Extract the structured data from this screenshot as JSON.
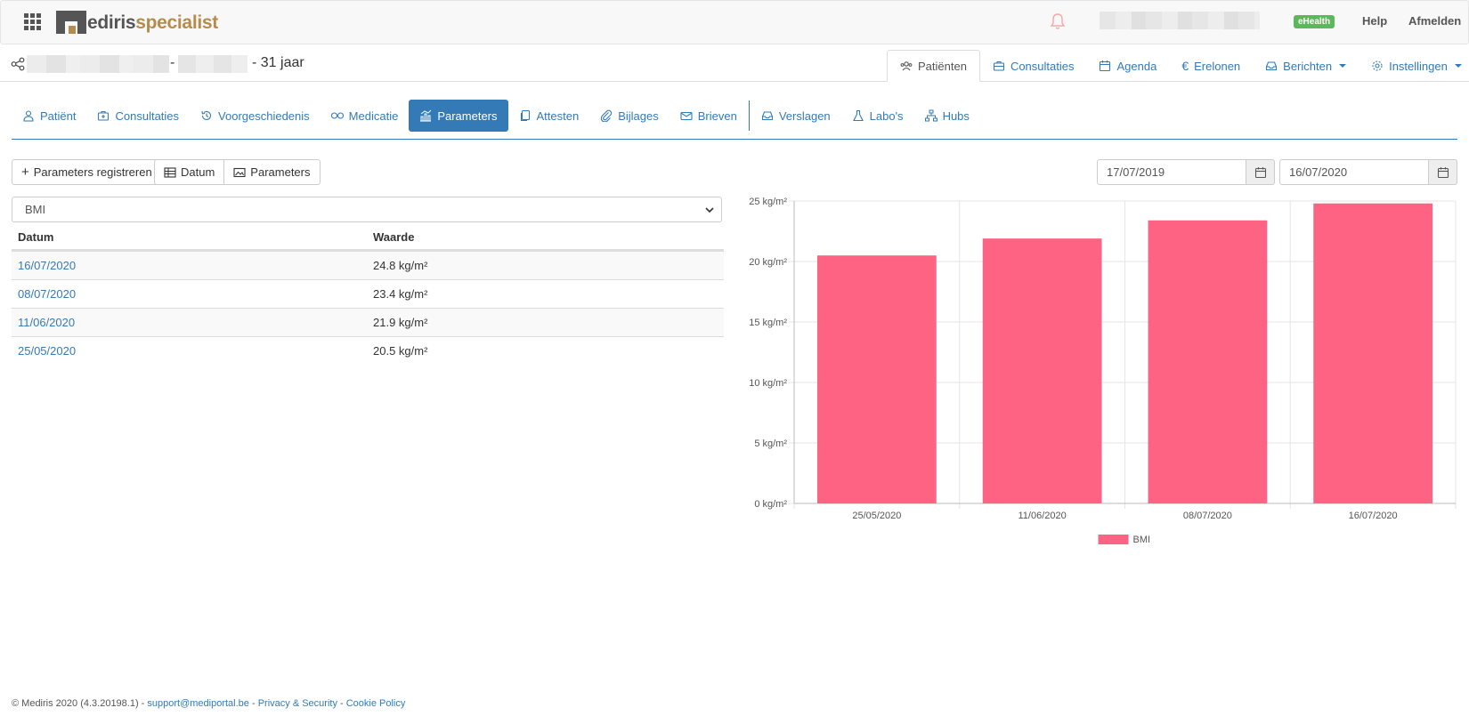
{
  "topbar": {
    "logo_part1": "ediris",
    "logo_part2": "specialist",
    "ehealth_badge": "eHealth",
    "help_label": "Help",
    "logout_label": "Afmelden"
  },
  "patient": {
    "separator": "-",
    "age": "- 31 jaar"
  },
  "main_nav": [
    {
      "label": "Patiënten",
      "icon": "users-icon",
      "active": true
    },
    {
      "label": "Consultaties",
      "icon": "briefcase-icon"
    },
    {
      "label": "Agenda",
      "icon": "calendar-icon"
    },
    {
      "label": "Erelonen",
      "icon": "euro-icon"
    },
    {
      "label": "Berichten",
      "icon": "inbox-icon"
    },
    {
      "label": "Instellingen",
      "icon": "gear-icon"
    }
  ],
  "sub_nav": [
    {
      "label": "Patiënt",
      "icon": "user-icon"
    },
    {
      "label": "Consultaties",
      "icon": "medkit-icon"
    },
    {
      "label": "Voorgeschiedenis",
      "icon": "history-icon"
    },
    {
      "label": "Medicatie",
      "icon": "pills-icon"
    },
    {
      "label": "Parameters",
      "icon": "chart-icon",
      "active": true
    },
    {
      "label": "Attesten",
      "icon": "copy-icon"
    },
    {
      "label": "Bijlages",
      "icon": "paperclip-icon"
    },
    {
      "label": "Brieven",
      "icon": "envelope-icon"
    },
    {
      "label": "Verslagen",
      "icon": "inbox-icon"
    },
    {
      "label": "Labo's",
      "icon": "flask-icon"
    },
    {
      "label": "Hubs",
      "icon": "sitemap-icon"
    }
  ],
  "toolbar": {
    "register_label": "Parameters registreren",
    "date_label": "Datum",
    "params_label": "Parameters",
    "date_from": "17/07/2019",
    "date_to": "16/07/2020"
  },
  "select": {
    "value": "BMI"
  },
  "table": {
    "headers": [
      "Datum",
      "Waarde"
    ],
    "rows": [
      {
        "date": "16/07/2020",
        "value": "24.8 kg/m²"
      },
      {
        "date": "08/07/2020",
        "value": "23.4 kg/m²"
      },
      {
        "date": "11/06/2020",
        "value": "21.9 kg/m²"
      },
      {
        "date": "25/05/2020",
        "value": "20.5 kg/m²"
      }
    ]
  },
  "chart_data": {
    "type": "bar",
    "categories": [
      "25/05/2020",
      "11/06/2020",
      "08/07/2020",
      "16/07/2020"
    ],
    "series": [
      {
        "name": "BMI",
        "values": [
          20.5,
          21.9,
          23.4,
          24.8
        ],
        "color": "#ff6384"
      }
    ],
    "ylim": [
      0,
      25
    ],
    "yticks": [
      "0 kg/m²",
      "5 kg/m²",
      "10 kg/m²",
      "15 kg/m²",
      "20 kg/m²",
      "25 kg/m²"
    ],
    "title": "",
    "xlabel": "",
    "ylabel": "",
    "grid": true,
    "legend": "bottom"
  },
  "footer": {
    "copyright": "© Mediris 2020 (4.3.20198.1) - ",
    "support": "support@mediportal.be",
    "sep1": " - ",
    "privacy": "Privacy & Security",
    "sep2": " - ",
    "cookie": "Cookie Policy"
  }
}
